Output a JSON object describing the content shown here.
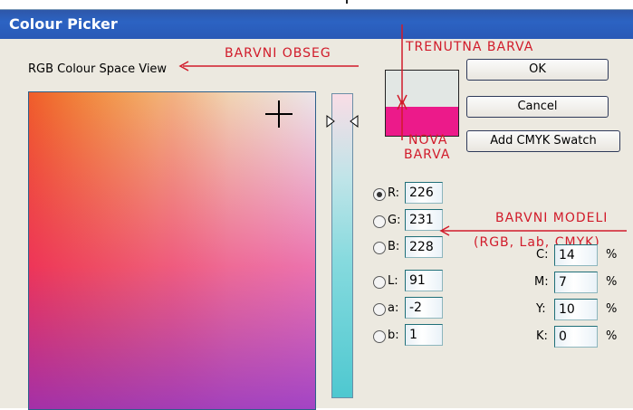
{
  "window": {
    "title": "Colour Picker"
  },
  "labels": {
    "space_view": "RGB Colour Space View"
  },
  "annotations": {
    "range": "BARVNI OBSEG",
    "current": "TRENUTNA BARVA",
    "new_line1": "NOVA",
    "new_line2": "BARVA",
    "models_line1": "BARVNI MODELI",
    "models_line2": "(RGB, Lab, CMYK)"
  },
  "colors": {
    "current": "#e2e7e4",
    "new": "#ec1a8a",
    "annotation": "#d11b2a"
  },
  "buttons": {
    "ok": "OK",
    "cancel": "Cancel",
    "add_cmyk": "Add CMYK Swatch"
  },
  "rgb": {
    "r": {
      "label": "R:",
      "value": "226"
    },
    "g": {
      "label": "G:",
      "value": "231"
    },
    "b": {
      "label": "B:",
      "value": "228"
    },
    "selected": "R"
  },
  "lab": {
    "l": {
      "label": "L:",
      "value": "91"
    },
    "a": {
      "label": "a:",
      "value": "-2"
    },
    "b": {
      "label": "b:",
      "value": "1"
    }
  },
  "cmyk": {
    "c": {
      "label": "C:",
      "value": "14",
      "unit": "%"
    },
    "m": {
      "label": "M:",
      "value": "7",
      "unit": "%"
    },
    "y": {
      "label": "Y:",
      "value": "10",
      "unit": "%"
    },
    "k": {
      "label": "K:",
      "value": "0",
      "unit": "%"
    }
  },
  "icons": {
    "crosshair": "crosshair-icon",
    "slider_thumb_left": "triangle-right-icon",
    "slider_thumb_right": "triangle-left-icon",
    "radio": "radio-icon"
  }
}
